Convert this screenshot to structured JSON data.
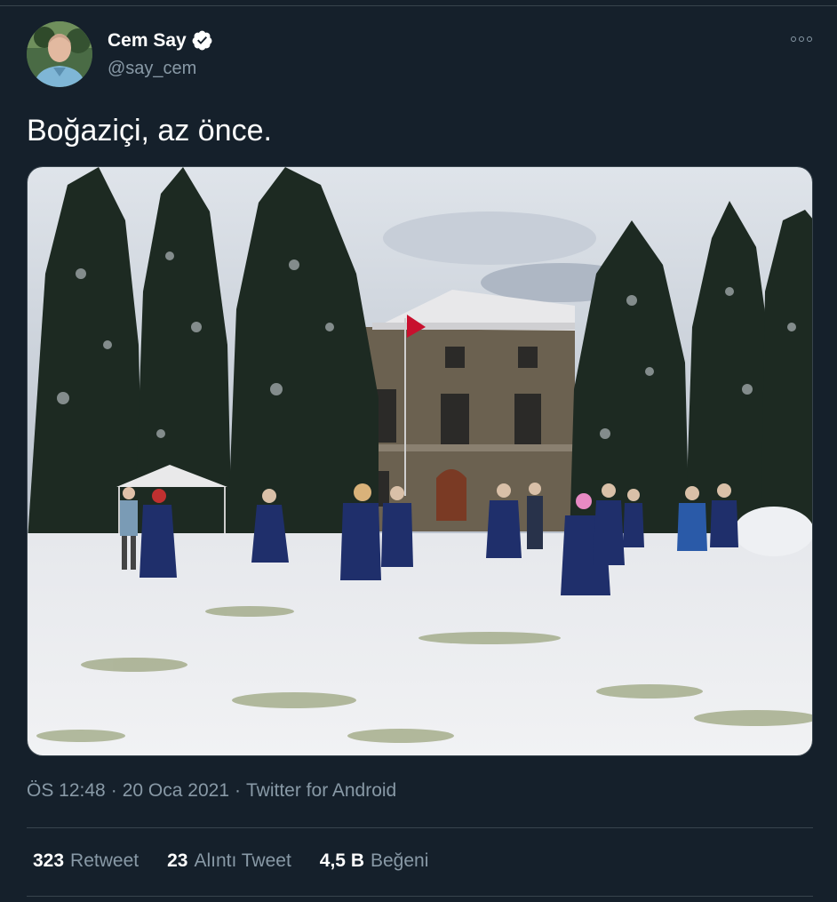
{
  "tweet": {
    "author": {
      "name": "Cem Say",
      "handle": "@say_cem",
      "verified": true
    },
    "text": "Boğaziçi, az önce.",
    "timestamp": "ÖS 12:48",
    "date": "20 Oca 2021",
    "separator": "·",
    "source": "Twitter for Android",
    "stats": [
      {
        "count": "323",
        "label": "Retweet"
      },
      {
        "count": "23",
        "label": "Alıntı Tweet"
      },
      {
        "count": "4,5 B",
        "label": "Beğeni"
      }
    ]
  },
  "colors": {
    "background": "#15202b",
    "secondary_text": "#8899a6",
    "border": "#38444d"
  },
  "icons": [
    "verified-badge-icon",
    "more-options-icon"
  ]
}
